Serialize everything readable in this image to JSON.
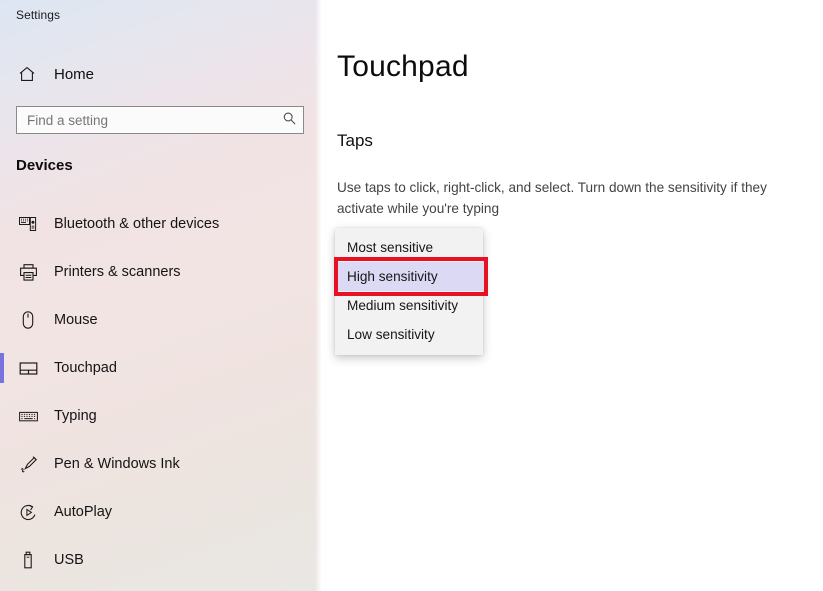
{
  "window": {
    "title": "Settings"
  },
  "sidebar": {
    "home": {
      "label": "Home",
      "icon": "home-icon"
    },
    "search": {
      "value": "",
      "placeholder": "Find a setting",
      "icon": "search-icon"
    },
    "group_header": "Devices",
    "items": [
      {
        "label": "Bluetooth & other devices",
        "icon": "bluetooth-devices-icon",
        "selected": false
      },
      {
        "label": "Printers & scanners",
        "icon": "printer-icon",
        "selected": false
      },
      {
        "label": "Mouse",
        "icon": "mouse-icon",
        "selected": false
      },
      {
        "label": "Touchpad",
        "icon": "touchpad-icon",
        "selected": true
      },
      {
        "label": "Typing",
        "icon": "keyboard-icon",
        "selected": false
      },
      {
        "label": "Pen & Windows Ink",
        "icon": "pen-icon",
        "selected": false
      },
      {
        "label": "AutoPlay",
        "icon": "autoplay-icon",
        "selected": false
      },
      {
        "label": "USB",
        "icon": "usb-icon",
        "selected": false
      }
    ]
  },
  "main": {
    "page_title": "Touchpad",
    "section_title": "Taps",
    "section_description": "Use taps to click, right-click, and select. Turn down the sensitivity if they activate while you're typing",
    "sensitivity_dropdown": {
      "selected": "High sensitivity",
      "options": [
        {
          "label": "Most sensitive",
          "selected": false
        },
        {
          "label": "High sensitivity",
          "selected": true
        },
        {
          "label": "Medium sensitivity",
          "selected": false
        },
        {
          "label": "Low sensitivity",
          "selected": false
        }
      ]
    }
  },
  "colors": {
    "accent": "#7a70e0",
    "highlight_box": "#e81123",
    "selected_item_bg": "#dcd9f5",
    "dropdown_bg": "#f2f2f2"
  }
}
